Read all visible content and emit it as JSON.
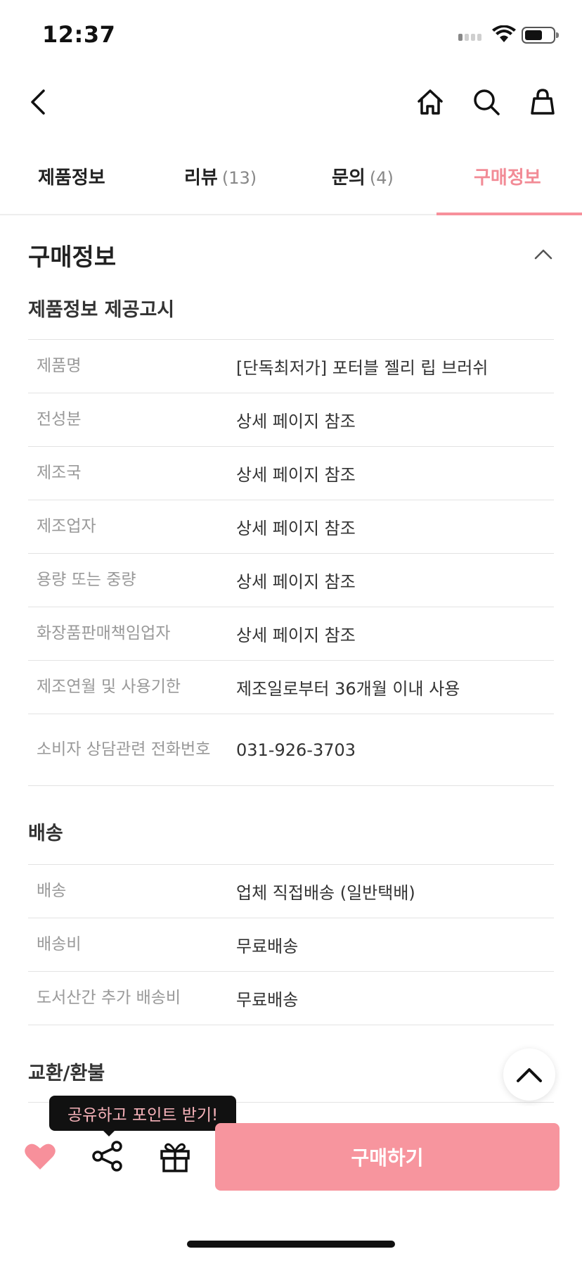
{
  "status": {
    "time": "12:37"
  },
  "tabs": [
    {
      "label": "제품정보",
      "count": ""
    },
    {
      "label": "리뷰",
      "count": "(13)"
    },
    {
      "label": "문의",
      "count": "(4)"
    },
    {
      "label": "구매정보",
      "count": ""
    }
  ],
  "section": {
    "title": "구매정보"
  },
  "product_notice": {
    "heading": "제품정보 제공고시",
    "rows": [
      {
        "label": "제품명",
        "value": "[단독최저가] 포터블 젤리 립 브러쉬"
      },
      {
        "label": "전성분",
        "value": "상세 페이지 참조"
      },
      {
        "label": "제조국",
        "value": "상세 페이지 참조"
      },
      {
        "label": "제조업자",
        "value": "상세 페이지 참조"
      },
      {
        "label": "용량 또는 중량",
        "value": "상세 페이지 참조"
      },
      {
        "label": "화장품판매책임업자",
        "value": "상세 페이지 참조"
      },
      {
        "label": "제조연월 및 사용기한",
        "value": "제조일로부터 36개월 이내 사용"
      },
      {
        "label": "소비자 상담관련 전화번호",
        "value": "031-926-3703"
      }
    ]
  },
  "shipping": {
    "heading": "배송",
    "rows": [
      {
        "label": "배송",
        "value": "업체 직접배송 (일반택배)"
      },
      {
        "label": "배송비",
        "value": "무료배송"
      },
      {
        "label": "도서산간 추가 배송비",
        "value": "무료배송"
      }
    ]
  },
  "exchange": {
    "heading": "교환/환불"
  },
  "bottom_bar": {
    "tooltip": "공유하고 포인트 받기!",
    "buy_label": "구매하기"
  },
  "colors": {
    "accent": "#f7959e",
    "active_tab": "#f28b96",
    "heart": "#f7909b"
  }
}
